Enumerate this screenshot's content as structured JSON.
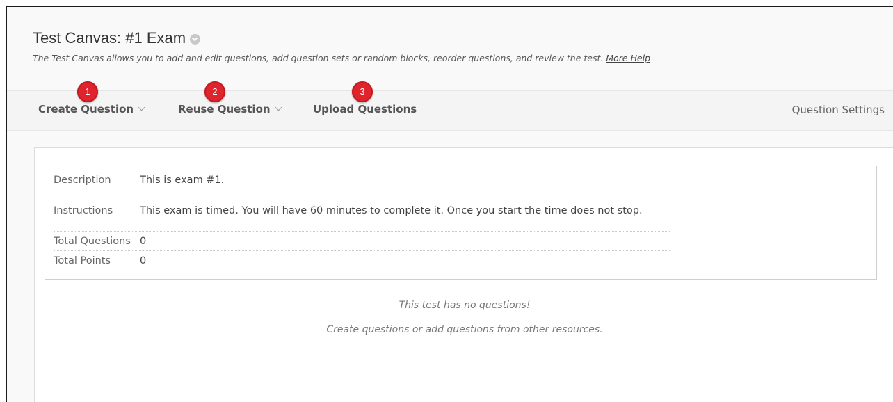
{
  "page": {
    "title": "Test Canvas: #1 Exam",
    "description": "The Test Canvas allows you to add and edit questions, add question sets or random blocks, reorder questions, and review the test.",
    "help_link": "More Help"
  },
  "toolbar": {
    "create_question": "Create Question",
    "reuse_question": "Reuse Question",
    "upload_questions": "Upload Questions",
    "question_settings": "Question Settings"
  },
  "callouts": [
    "1",
    "2",
    "3"
  ],
  "callout_color": "#e0242d",
  "test_info": {
    "rows": [
      {
        "label": "Description",
        "value": "This is exam #1."
      },
      {
        "label": "Instructions",
        "value": "This exam is timed. You will have 60 minutes to complete it. Once you start the time does not stop."
      },
      {
        "label": "Total Questions",
        "value": "0"
      },
      {
        "label": "Total Points",
        "value": "0"
      }
    ]
  },
  "empty_state": {
    "line1": "This test has no questions!",
    "line2": "Create questions or add questions from other resources."
  }
}
